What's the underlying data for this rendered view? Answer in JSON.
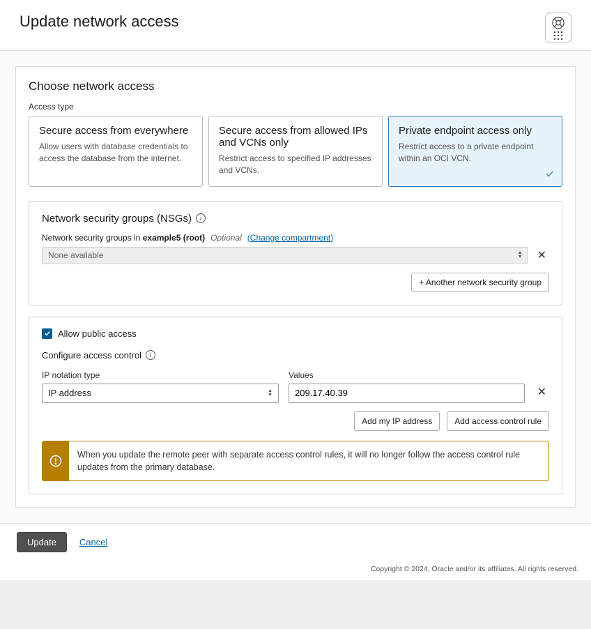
{
  "header": {
    "title": "Update network access"
  },
  "section": {
    "title": "Choose network access",
    "access_type_label": "Access type"
  },
  "options": [
    {
      "title": "Secure access from everywhere",
      "desc": "Allow users with database credentials to access the database from the internet.",
      "selected": false
    },
    {
      "title": "Secure access from allowed IPs and VCNs only",
      "desc": "Restrict access to specified IP addresses and VCNs.",
      "selected": false
    },
    {
      "title": "Private endpoint access only",
      "desc": "Restrict access to a private endpoint within an OCI VCN.",
      "selected": true
    }
  ],
  "nsg": {
    "heading": "Network security groups (NSGs)",
    "label_prefix": "Network security groups in ",
    "compartment": "example5 (root)",
    "optional": "Optional",
    "change_link": "(Change compartment)",
    "select_text": "None available",
    "add_button": "+ Another network security group"
  },
  "acl": {
    "allow_public": "Allow public access",
    "configure_label": "Configure access control",
    "ip_type_label": "IP notation type",
    "ip_type_value": "IP address",
    "values_label": "Values",
    "values_value": "209.17.40.39",
    "add_ip_btn": "Add my IP address",
    "add_rule_btn": "Add access control rule",
    "warning": "When you update the remote peer with separate access control rules, it will no longer follow the access control rule updates from the primary database."
  },
  "footer": {
    "update": "Update",
    "cancel": "Cancel",
    "copyright": "Copyright © 2024, Oracle and/or its affiliates. All rights reserved."
  }
}
